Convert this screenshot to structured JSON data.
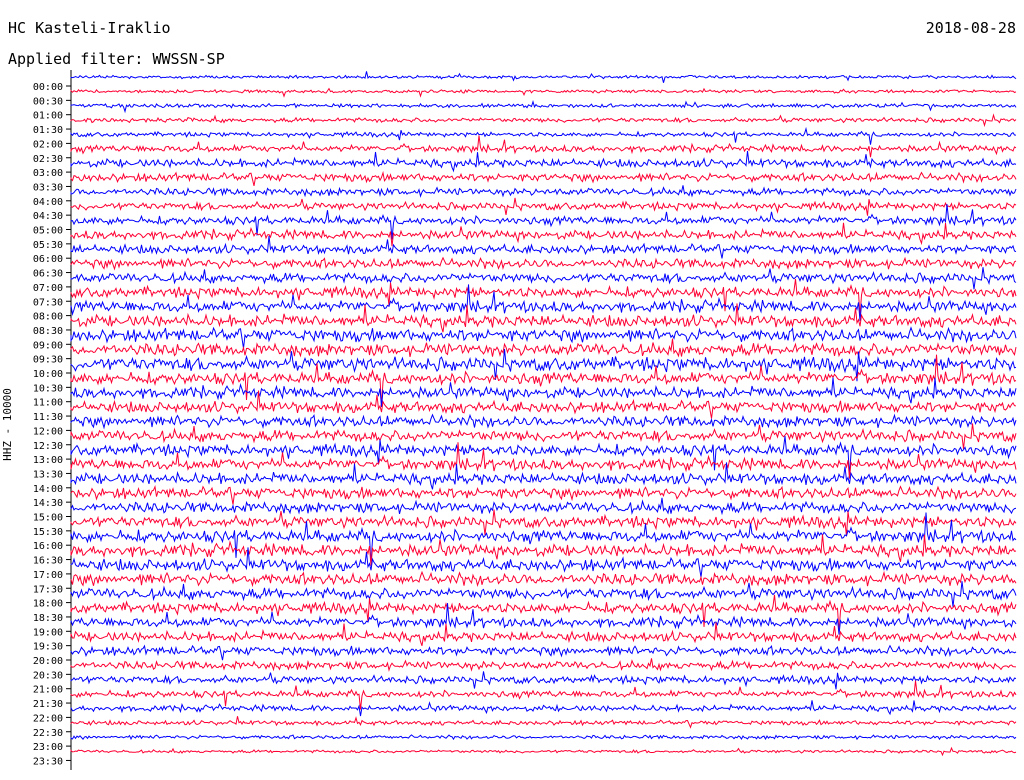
{
  "header": {
    "station": "HC Kasteli-Iraklio",
    "date": "2018-08-28",
    "filter": "Applied filter: WWSSN-SP"
  },
  "chart_data": {
    "type": "line",
    "title": "HC Kasteli-Iraklio",
    "ylabel": "HHZ - 10000",
    "row_labels": [
      "00:00",
      "00:30",
      "01:00",
      "01:30",
      "02:00",
      "02:30",
      "03:00",
      "03:30",
      "04:00",
      "04:30",
      "05:00",
      "05:30",
      "06:00",
      "06:30",
      "07:00",
      "07:30",
      "08:00",
      "08:30",
      "09:00",
      "09:30",
      "10:00",
      "10:30",
      "11:00",
      "11:30",
      "12:00",
      "12:30",
      "13:00",
      "13:30",
      "14:00",
      "14:30",
      "15:00",
      "15:30",
      "16:00",
      "16:30",
      "17:00",
      "17:30",
      "18:00",
      "18:30",
      "19:00",
      "19:30",
      "20:00",
      "20:30",
      "21:00",
      "21:30",
      "22:00",
      "22:30",
      "23:00",
      "23:30"
    ],
    "colors": [
      "#0000ff",
      "#ff0033"
    ],
    "relative_activity": [
      0.4,
      0.4,
      0.5,
      0.6,
      0.6,
      0.9,
      1.1,
      1.1,
      1.0,
      1.0,
      1.1,
      1.2,
      1.2,
      1.3,
      1.3,
      1.4,
      1.5,
      1.6,
      1.7,
      1.7,
      1.8,
      1.6,
      1.5,
      1.5,
      1.5,
      1.5,
      1.5,
      1.5,
      1.5,
      1.5,
      1.5,
      1.5,
      1.6,
      1.6,
      1.6,
      1.6,
      1.5,
      1.4,
      1.3,
      1.3,
      1.2,
      1.1,
      1.0,
      0.9,
      0.8,
      0.6,
      0.5,
      0.4
    ]
  }
}
